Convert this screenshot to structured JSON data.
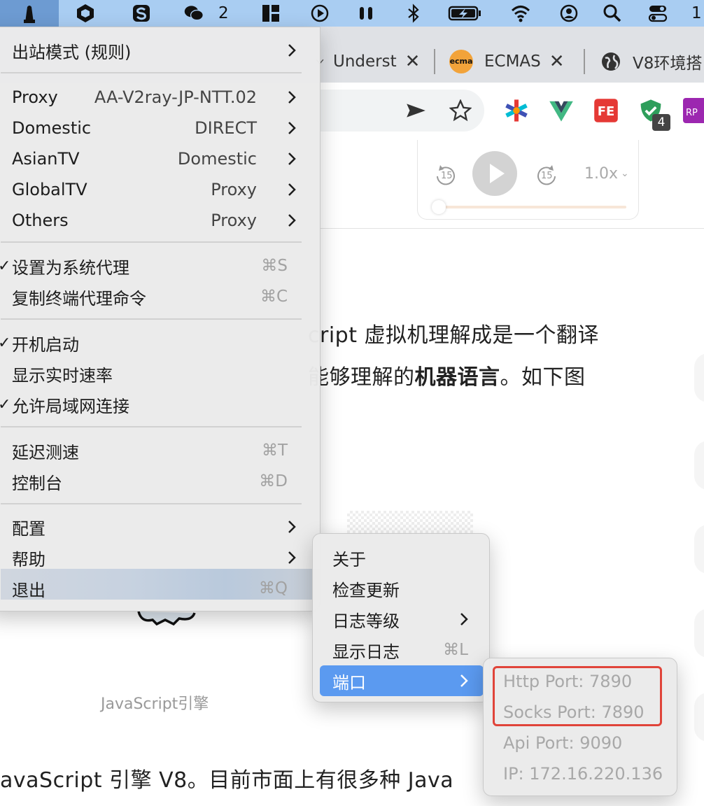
{
  "menubar": {
    "wechat_count": "2",
    "clock_fragment": "1"
  },
  "browser": {
    "tabs": [
      {
        "title": "Underst",
        "close": "✕"
      },
      {
        "favicon_text": "ecma",
        "title": "ECMAS",
        "close": "✕"
      },
      {
        "title": "V8环境搭",
        "close": ""
      }
    ],
    "extension_badge": "4",
    "extension_label": "RP"
  },
  "player": {
    "rewind_label": "15",
    "forward_label": "15",
    "speed": "1.0x"
  },
  "article": {
    "line1": "cript 虚拟机理解成是一个翻译",
    "line2_prefix": "能够理解的",
    "line2_bold": "机器语言",
    "line2_suffix": "。如下图",
    "caption": "JavaScript引擎",
    "bottom": "avaScript 引擎 V8。目前市面上有很多种 Java"
  },
  "main_menu": {
    "outbound_mode": "出站模式 (规则)",
    "groups": [
      {
        "label": "Proxy",
        "value": "AA-V2ray-JP-NTT.02"
      },
      {
        "label": "Domestic",
        "value": "DIRECT"
      },
      {
        "label": "AsianTV",
        "value": "Domestic"
      },
      {
        "label": "GlobalTV",
        "value": "Proxy"
      },
      {
        "label": "Others",
        "value": "Proxy"
      }
    ],
    "set_system_proxy": {
      "label": "设置为系统代理",
      "shortcut": "⌘S",
      "check": "✓"
    },
    "copy_terminal_cmd": {
      "label": "复制终端代理命令",
      "shortcut": "⌘C"
    },
    "launch_at_login": {
      "label": "开机启动",
      "check": "✓"
    },
    "show_speed": {
      "label": "显示实时速率"
    },
    "allow_lan": {
      "label": "允许局域网连接",
      "check": "✓"
    },
    "latency_test": {
      "label": "延迟测速",
      "shortcut": "⌘T"
    },
    "dashboard": {
      "label": "控制台",
      "shortcut": "⌘D"
    },
    "config": {
      "label": "配置"
    },
    "help": {
      "label": "帮助"
    },
    "quit": {
      "label": "退出",
      "shortcut": "⌘Q"
    }
  },
  "help_menu": {
    "about": "关于",
    "check_update": "检查更新",
    "log_level": "日志等级",
    "show_log": {
      "label": "显示日志",
      "shortcut": "⌘L"
    },
    "ports": "端口"
  },
  "ports_menu": {
    "http": "Http Port: 7890",
    "socks": "Socks Port: 7890",
    "api": "Api Port: 9090",
    "ip": "IP: 172.16.220.136"
  },
  "colors": {
    "menubar": "#a9cdf2",
    "highlight": "#5b9af0",
    "redbox": "#e0443a"
  }
}
